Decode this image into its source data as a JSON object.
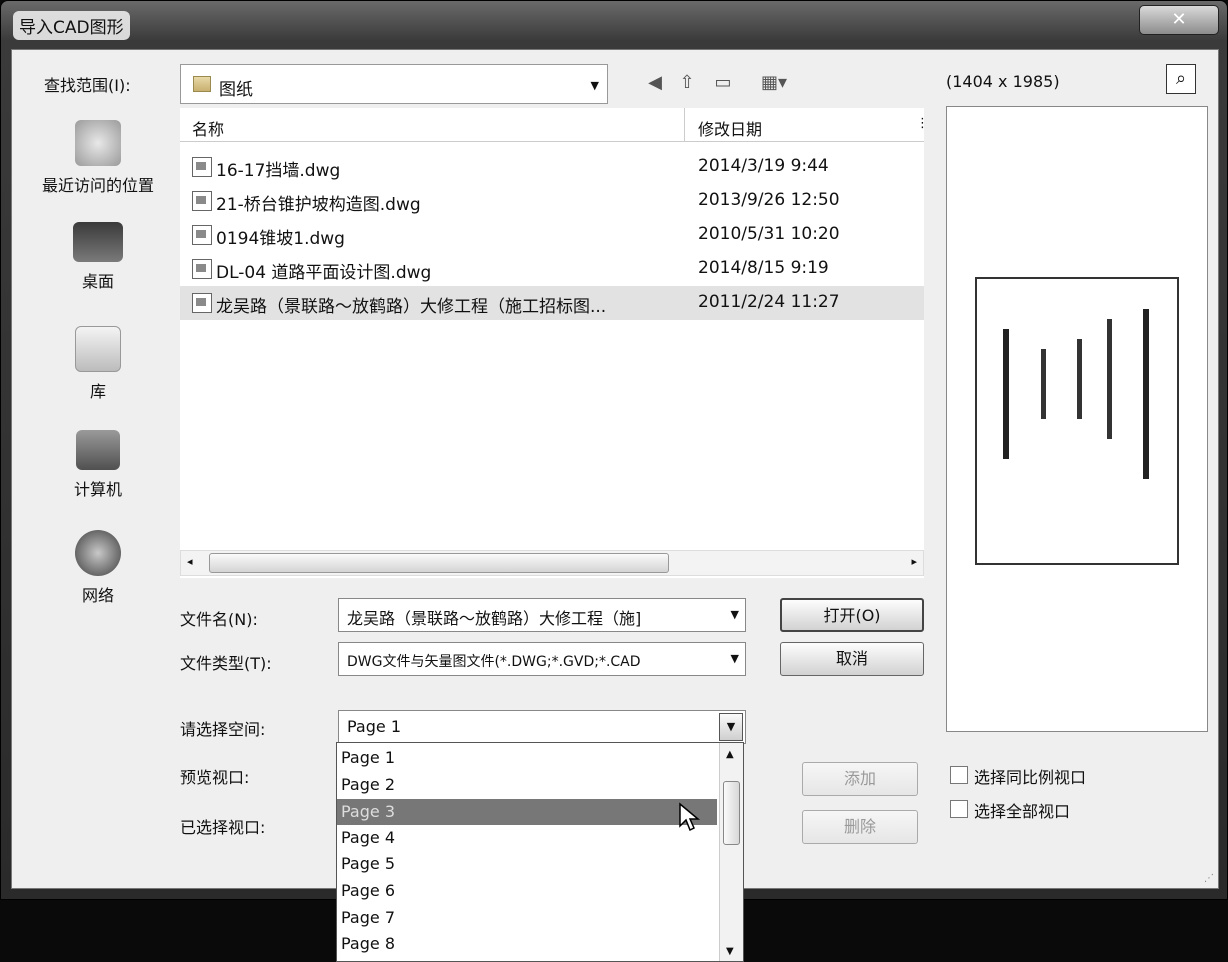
{
  "window": {
    "title": "导入CAD图形",
    "close_glyph": "✕"
  },
  "lookin": {
    "label": "查找范围(I):",
    "value": "图纸"
  },
  "preview": {
    "size_label": "(1404 x 1985)"
  },
  "places": [
    {
      "label": "最近访问的位置",
      "icon": "recent-places-icon"
    },
    {
      "label": "桌面",
      "icon": "desktop-icon"
    },
    {
      "label": "库",
      "icon": "library-icon"
    },
    {
      "label": "计算机",
      "icon": "computer-icon"
    },
    {
      "label": "网络",
      "icon": "network-icon"
    }
  ],
  "columns": {
    "name": "名称",
    "date": "修改日期"
  },
  "files": [
    {
      "name": "16-17挡墙.dwg",
      "date": "2014/3/19 9:44"
    },
    {
      "name": "21-桥台锥护坡构造图.dwg",
      "date": "2013/9/26 12:50"
    },
    {
      "name": "0194锥坡1.dwg",
      "date": "2010/5/31 10:20"
    },
    {
      "name": "DL-04 道路平面设计图.dwg",
      "date": "2014/8/15 9:19"
    },
    {
      "name": "龙吴路（景联路～放鹤路）大修工程（施工招标图...",
      "date": "2011/2/24 11:27"
    }
  ],
  "form": {
    "filename_label": "文件名(N):",
    "filename_value": "龙吴路（景联路～放鹤路）大修工程（施]",
    "filetype_label": "文件类型(T):",
    "filetype_value": "DWG文件与矢量图文件(*.DWG;*.GVD;*.CAD",
    "space_label": "请选择空间:",
    "space_value": "Page 1",
    "preview_view_label": "预览视口:",
    "selected_view_label": "已选择视口:"
  },
  "buttons": {
    "open": "打开(O)",
    "cancel": "取消",
    "add": "添加",
    "delete": "删除"
  },
  "options": {
    "same_scale": "选择同比例视口",
    "all_views": "选择全部视口"
  },
  "pages": [
    "Page 1",
    "Page 2",
    "Page 3",
    "Page 4",
    "Page 5",
    "Page 6",
    "Page 7",
    "Page 8"
  ],
  "highlighted_page": "Page 3"
}
